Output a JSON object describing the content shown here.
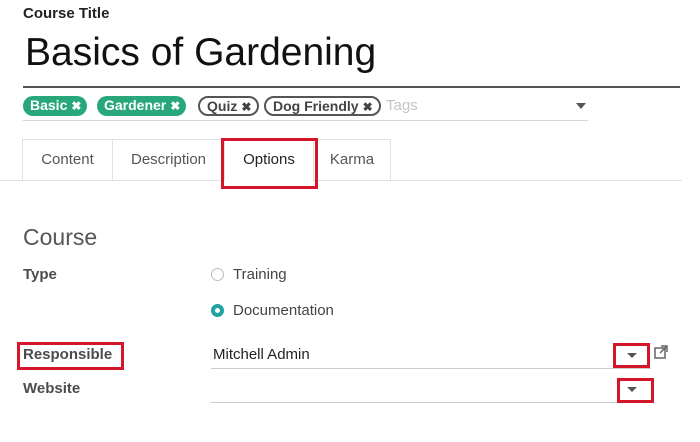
{
  "form": {
    "course_title_label": "Course Title",
    "course_title_value": "Basics of Gardening",
    "tags": [
      {
        "label": "Basic",
        "style": "filled",
        "color": "#28a87a"
      },
      {
        "label": "Gardener",
        "style": "filled",
        "color": "#28a87a"
      },
      {
        "label": "Quiz",
        "style": "outline"
      },
      {
        "label": "Dog Friendly",
        "style": "outline"
      }
    ],
    "tags_placeholder": "Tags",
    "tabs": [
      {
        "label": "Content",
        "active": false
      },
      {
        "label": "Description",
        "active": false
      },
      {
        "label": "Options",
        "active": true
      },
      {
        "label": "Karma",
        "active": false
      }
    ]
  },
  "options": {
    "section_title": "Course",
    "type_label": "Type",
    "type_options": [
      {
        "label": "Training",
        "selected": false
      },
      {
        "label": "Documentation",
        "selected": true
      }
    ],
    "responsible_label": "Responsible",
    "responsible_value": "Mitchell Admin",
    "website_label": "Website",
    "website_value": ""
  },
  "colors": {
    "accent_teal": "#1fa3a3",
    "tag_green": "#28a87a",
    "highlight_red": "#d3162a"
  },
  "icons": {
    "close": "close-icon",
    "dropdown": "caret-down-icon",
    "external_link": "external-link-icon"
  }
}
